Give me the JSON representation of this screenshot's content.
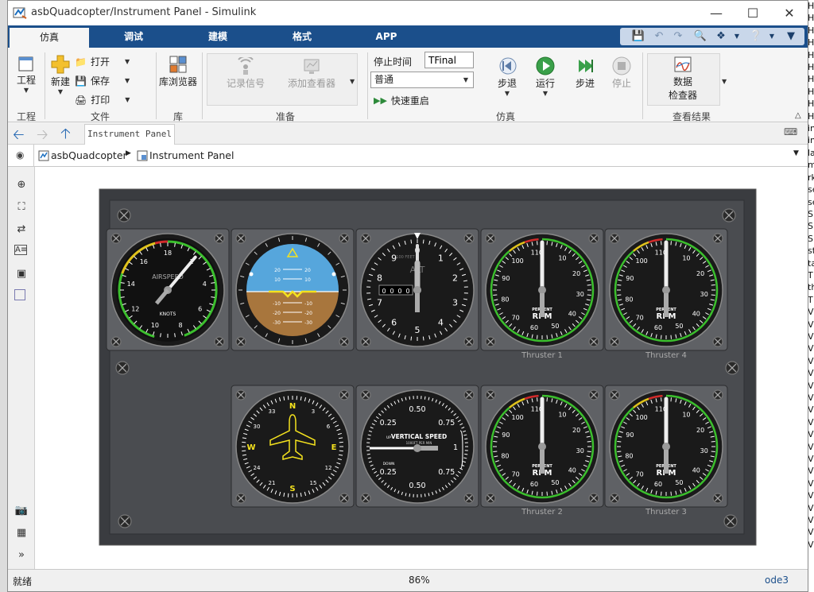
{
  "window": {
    "title": "asbQuadcopter/Instrument Panel - Simulink"
  },
  "background_right_text": [
    "H",
    "H",
    "H",
    "H",
    "H",
    "H",
    "H",
    "H",
    "H",
    "H",
    "in",
    "in",
    "la",
    "m",
    "rk",
    "se",
    "se",
    "S",
    "S",
    "S",
    "st",
    "ta",
    "T",
    "th",
    "T",
    "V",
    "V",
    "V",
    "V",
    "V",
    "V",
    "V",
    "V",
    "V",
    "V",
    "V",
    "V",
    "V",
    "V",
    "V",
    "V",
    "V",
    "V",
    "V",
    "V"
  ],
  "tabs": [
    {
      "label": "仿真",
      "active": true
    },
    {
      "label": "调试"
    },
    {
      "label": "建模"
    },
    {
      "label": "格式"
    },
    {
      "label": "APP"
    }
  ],
  "ribbon": {
    "project": {
      "label": "工程",
      "group": "工程"
    },
    "file": {
      "new": "新建",
      "open": "打开",
      "save": "保存",
      "print": "打印",
      "group": "文件"
    },
    "library": {
      "label": "库浏览器",
      "group": "库"
    },
    "prepare": {
      "log_signals": "记录信号",
      "add_viewer": "添加查看器",
      "group": "准备"
    },
    "simulate": {
      "stop_time_label": "停止时间",
      "stop_time_value": "TFinal",
      "mode_value": "普通",
      "fast_restart": "快速重启",
      "step_back": "步退",
      "run": "运行",
      "step_forward": "步进",
      "stop": "停止",
      "group": "仿真"
    },
    "results": {
      "data_inspector_line1": "数据",
      "data_inspector_line2": "检查器",
      "group": "查看结果"
    }
  },
  "nav": {
    "tab": "Instrument Panel"
  },
  "breadcrumb": {
    "root": "asbQuadcopter",
    "child": "Instrument Panel"
  },
  "panel": {
    "airspeed": {
      "title": "AIRSPEED",
      "unit": "KNOTS",
      "ticks": [
        "18",
        "2",
        "4",
        "6",
        "8",
        "10",
        "12",
        "14",
        "16"
      ],
      "needle_value": 2
    },
    "horizon": {
      "pitch_labels": [
        "20",
        "10",
        "10",
        "20",
        "-10",
        "-20",
        "-30",
        "-10",
        "-20",
        "-30"
      ]
    },
    "altimeter": {
      "title": "ALT",
      "subtitle": "100 FEET",
      "ticks": [
        "0",
        "1",
        "2",
        "3",
        "4",
        "5",
        "6",
        "7",
        "8",
        "9"
      ],
      "drum": [
        "0",
        "0",
        "0",
        "0"
      ]
    },
    "thrusters": [
      {
        "label": "Thruster 1"
      },
      {
        "label": "Thruster 4"
      },
      {
        "label": "Thruster 2"
      },
      {
        "label": "Thruster 3"
      }
    ],
    "rpm": {
      "ticks": [
        "0",
        "10",
        "20",
        "30",
        "40",
        "50",
        "60",
        "70",
        "80",
        "90",
        "100",
        "110"
      ],
      "line1": "PERCENT",
      "line2": "RPM"
    },
    "heading": {
      "letters": [
        "N",
        "E",
        "S",
        "W"
      ],
      "numbers": [
        "3",
        "6",
        "12",
        "15",
        "21",
        "24",
        "30",
        "33"
      ]
    },
    "vsi": {
      "title": "VERTICAL SPEED",
      "subtitle": "1000FT PER MIN",
      "up": "UP",
      "down": "DOWN",
      "ticks": [
        "0.25",
        "0.50",
        "0.75",
        "1",
        "0.75",
        "0.50",
        "0.25"
      ]
    }
  },
  "status": {
    "left": "就绪",
    "zoom": "86%",
    "solver": "ode3"
  }
}
